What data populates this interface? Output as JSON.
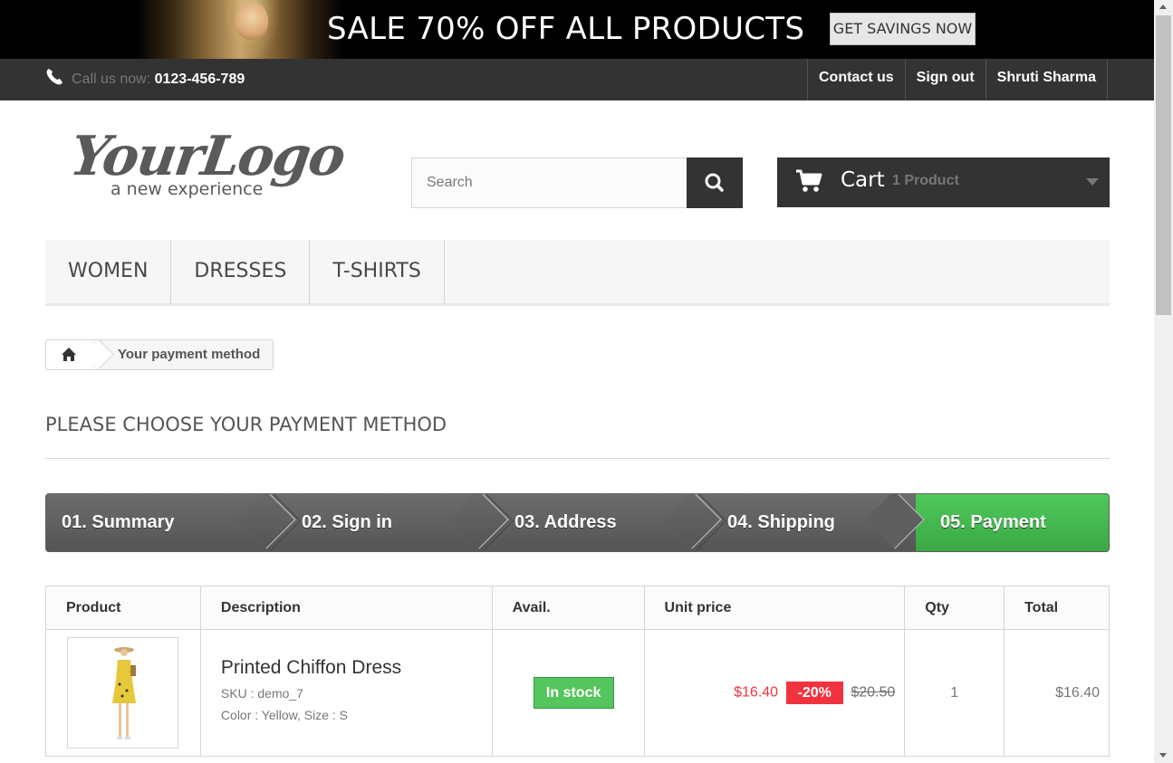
{
  "banner": {
    "title": "SALE 70% OFF ALL PRODUCTS",
    "button": "GET SAVINGS NOW"
  },
  "topnav": {
    "call_prefix": "Call us now: ",
    "phone": "0123-456-789",
    "links": [
      "Contact us",
      "Sign out",
      "Shruti Sharma"
    ]
  },
  "logo": {
    "main": "YourLogo",
    "tagline": "a new experience"
  },
  "search": {
    "placeholder": "Search"
  },
  "cart": {
    "label": "Cart",
    "count": "1 Product"
  },
  "menu": [
    "WOMEN",
    "DRESSES",
    "T-SHIRTS"
  ],
  "breadcrumb": {
    "current": "Your payment method"
  },
  "page_heading": "PLEASE CHOOSE YOUR PAYMENT METHOD",
  "steps": [
    "01. Summary",
    "02. Sign in",
    "03. Address",
    "04. Shipping",
    "05. Payment"
  ],
  "table": {
    "headers": [
      "Product",
      "Description",
      "Avail.",
      "Unit price",
      "Qty",
      "Total"
    ],
    "rows": [
      {
        "name": "Printed Chiffon Dress",
        "sku": "SKU : demo_7",
        "attributes": "Color : Yellow, Size : S",
        "availability": "In stock",
        "price": "$16.40",
        "reduction": "-20%",
        "old_price": "$20.50",
        "qty": "1",
        "total": "$16.40"
      }
    ]
  },
  "colors": {
    "accent_green": "#46b450",
    "dark": "#333333",
    "sale_red": "#f13340"
  }
}
